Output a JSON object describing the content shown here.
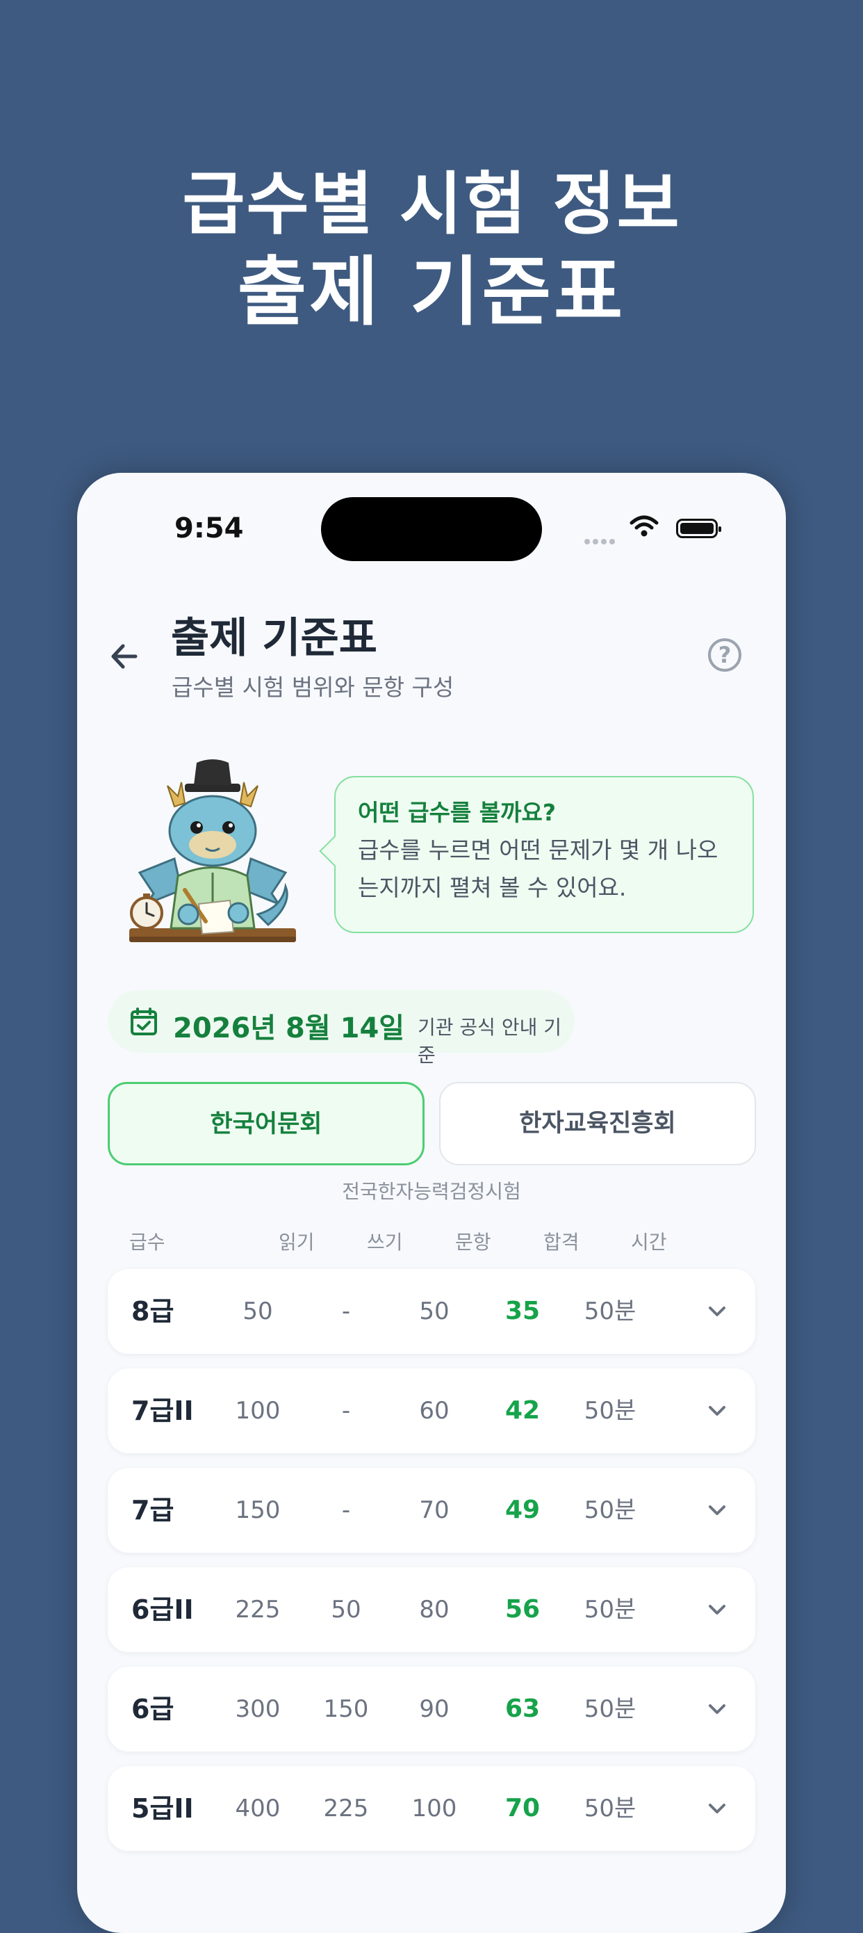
{
  "hero": {
    "line1": "급수별 시험 정보",
    "line2": "출제 기준표"
  },
  "status": {
    "time": "9:54"
  },
  "header": {
    "title": "출제 기준표",
    "subtitle": "급수별 시험 범위와 문항 구성",
    "help_glyph": "?"
  },
  "bubble": {
    "title": "어떤 급수를 볼까요?",
    "body_line1": "급수를 누르면 어떤 문제가 몇 개 나오",
    "body_line2": "는지까지 펼쳐 볼 수 있어요."
  },
  "date_chip": {
    "date": "2026년 8월 14일",
    "note": "기관 공식 안내 기준"
  },
  "segments": {
    "active": "한국어문회",
    "inactive": "한자교육진흥회",
    "note": "전국한자능력검정시험"
  },
  "table": {
    "headers": {
      "grade": "급수",
      "read": "읽기",
      "write": "쓰기",
      "questions": "문항",
      "pass": "합격",
      "time": "시간"
    },
    "rows": [
      {
        "grade": "8급",
        "read": "50",
        "write": "-",
        "questions": "50",
        "pass": "35",
        "time": "50분"
      },
      {
        "grade": "7급II",
        "read": "100",
        "write": "-",
        "questions": "60",
        "pass": "42",
        "time": "50분"
      },
      {
        "grade": "7급",
        "read": "150",
        "write": "-",
        "questions": "70",
        "pass": "49",
        "time": "50분"
      },
      {
        "grade": "6급II",
        "read": "225",
        "write": "50",
        "questions": "80",
        "pass": "56",
        "time": "50분"
      },
      {
        "grade": "6급",
        "read": "300",
        "write": "150",
        "questions": "90",
        "pass": "63",
        "time": "50분"
      },
      {
        "grade": "5급II",
        "read": "400",
        "write": "225",
        "questions": "100",
        "pass": "70",
        "time": "50분"
      }
    ]
  },
  "colors": {
    "background": "#3e5a80",
    "accent_green": "#16a34a",
    "title_text": "#1f2937"
  },
  "icons": [
    "back-arrow-icon",
    "help-icon",
    "calendar-check-icon",
    "chevron-down-icon",
    "wifi-icon",
    "battery-icon",
    "dragon-scholar-mascot"
  ]
}
